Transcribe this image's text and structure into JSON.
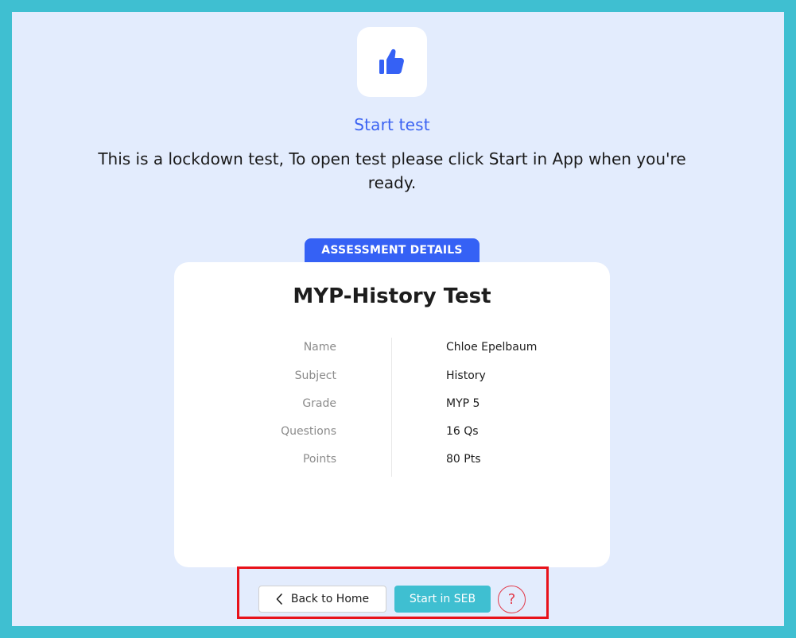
{
  "header": {
    "icon": "thumbs-up-icon",
    "title": "Start test",
    "message": "This is a lockdown test, To open test please click Start in App when you're ready."
  },
  "details": {
    "tab_label": "ASSESSMENT DETAILS",
    "test_title": "MYP-History Test",
    "rows": [
      {
        "label": "Name",
        "value": "Chloe Epelbaum"
      },
      {
        "label": "Subject",
        "value": "History"
      },
      {
        "label": "Grade",
        "value": "MYP 5"
      },
      {
        "label": "Questions",
        "value": "16 Qs"
      },
      {
        "label": "Points",
        "value": "80 Pts"
      }
    ]
  },
  "actions": {
    "back_label": "Back to Home",
    "back_icon": "chevron-left-icon",
    "start_label": "Start in SEB",
    "help_icon": "question-mark-icon",
    "help_glyph": "?"
  },
  "colors": {
    "page_border": "#3fbfd1",
    "background": "#e3ecfd",
    "accent_blue": "#3561f5",
    "start_button": "#3fbfd1",
    "help_red": "#e23a4a",
    "highlight_red": "#e8121a"
  }
}
